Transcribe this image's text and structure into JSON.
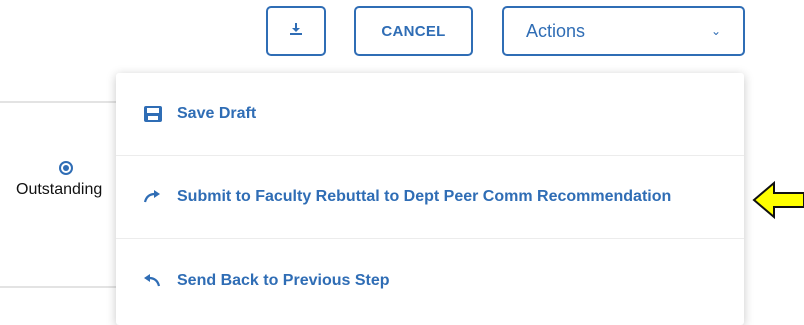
{
  "toolbar": {
    "download_icon": "download-icon",
    "cancel_label": "CANCEL",
    "actions_label": "Actions",
    "actions_chevron": "⌄"
  },
  "form": {
    "radio_label": "Outstanding"
  },
  "menu": {
    "items": [
      {
        "label": "Save Draft",
        "icon": "save-icon"
      },
      {
        "label": "Submit to Faculty Rebuttal to Dept Peer Comm Recommendation",
        "icon": "forward-arrow-icon"
      },
      {
        "label": "Send Back to Previous Step",
        "icon": "back-arrow-icon"
      }
    ]
  },
  "colors": {
    "accent": "#2f6db5",
    "highlight_arrow_fill": "#ffff00"
  }
}
